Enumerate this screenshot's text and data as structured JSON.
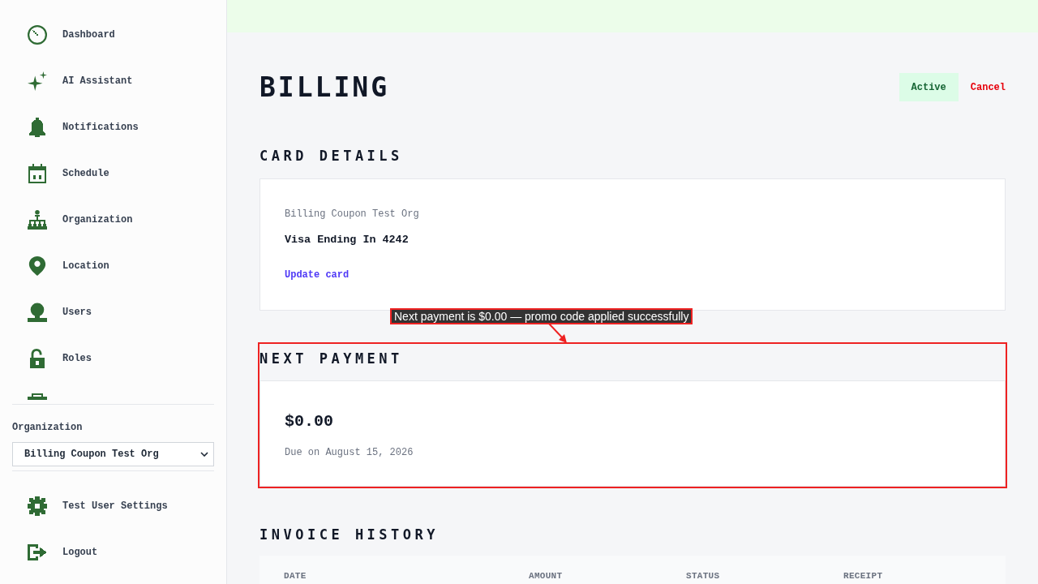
{
  "sidebar": {
    "nav_items": [
      {
        "label": "Dashboard"
      },
      {
        "label": "AI Assistant"
      },
      {
        "label": "Notifications"
      },
      {
        "label": "Schedule"
      },
      {
        "label": "Organization"
      },
      {
        "label": "Location"
      },
      {
        "label": "Users"
      },
      {
        "label": "Roles"
      }
    ],
    "organization_label": "Organization",
    "organization_select": {
      "value": "Billing Coupon Test Org"
    },
    "footer_items": [
      {
        "label": "Test User Settings"
      },
      {
        "label": "Logout"
      }
    ]
  },
  "page": {
    "title": "BILLING",
    "status_badge": "Active",
    "cancel_link": "Cancel"
  },
  "card_details": {
    "heading": "CARD DETAILS",
    "organization": "Billing Coupon Test Org",
    "card": "Visa Ending In 4242",
    "update_link": "Update card"
  },
  "next_payment": {
    "heading": "NEXT PAYMENT",
    "amount": "$0.00",
    "due": "Due on August 15, 2026",
    "highlighted": true,
    "callout": "Next payment is $0.00 — promo code applied successfully"
  },
  "invoice_history": {
    "heading": "INVOICE HISTORY",
    "columns": [
      "DATE",
      "AMOUNT",
      "STATUS",
      "RECEIPT"
    ]
  }
}
